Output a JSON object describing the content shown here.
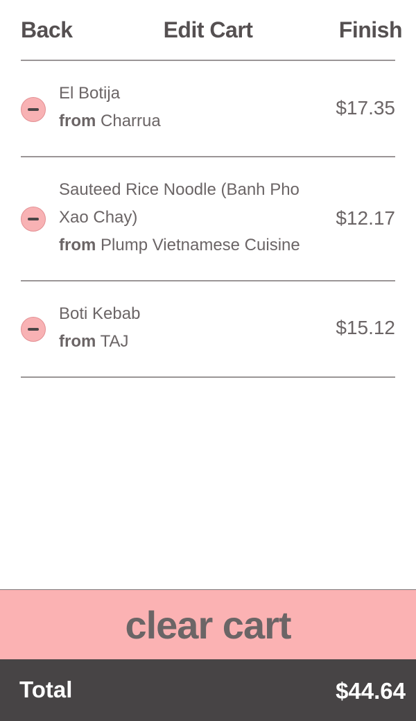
{
  "header": {
    "back_label": "Back",
    "title": "Edit Cart",
    "finish_label": "Finish"
  },
  "cart": {
    "from_word": "from",
    "items": [
      {
        "name_line1": "El Botija",
        "name_line2": "",
        "restaurant": "Charrua",
        "price": "$17.35"
      },
      {
        "name_line1": "Sauteed Rice Noodle (Banh Pho",
        "name_line2": "Xao Chay)",
        "restaurant": "Plump Vietnamese Cuisine",
        "price": "$12.17"
      },
      {
        "name_line1": "Boti Kebab",
        "name_line2": "",
        "restaurant": "TAJ",
        "price": "$15.12"
      }
    ]
  },
  "actions": {
    "clear_cart_label": "clear cart"
  },
  "footer": {
    "total_label": "Total",
    "total_value": "$44.64"
  },
  "colors": {
    "accent_pink": "#fbb2b3",
    "footer_dark": "#474445",
    "text_gray": "#6b6566"
  },
  "icons": {
    "remove": "minus-circle-icon"
  }
}
